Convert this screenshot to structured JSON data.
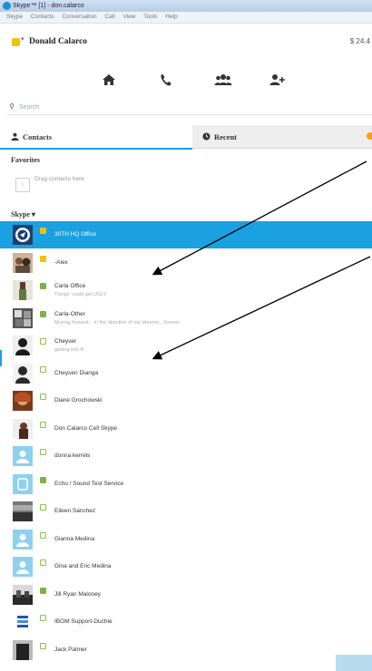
{
  "window": {
    "title": "Skype™ [1] - don.calarco"
  },
  "menu": [
    "Skype",
    "Contacts",
    "Conversation",
    "Call",
    "View",
    "Tools",
    "Help"
  ],
  "profile": {
    "name": "Donald Calarco",
    "credit": "$ 24.4"
  },
  "nav": [
    {
      "icon": "home-icon"
    },
    {
      "icon": "phone-icon"
    },
    {
      "icon": "group-icon"
    },
    {
      "icon": "add-contact-icon"
    }
  ],
  "search": {
    "placeholder": "Search"
  },
  "tabs": {
    "contacts": "Contacts",
    "recent": "Recent"
  },
  "favorites": {
    "label": "Favorites",
    "hint": "Drag contacts here",
    "box_text": "☆"
  },
  "skype_section": {
    "label": "Skype ▾"
  },
  "contacts": [
    {
      "name": "30TH HQ Office",
      "mood": "",
      "status": "away",
      "selected": true,
      "avatar": "logo"
    },
    {
      "name": "-Alex",
      "mood": "",
      "status": "away",
      "avatar": "photo-a"
    },
    {
      "name": "Carla Office",
      "mood": "Things' could get UGLY",
      "status": "online",
      "avatar": "photo-b"
    },
    {
      "name": "Carla-Other",
      "mood": "Moving forward... in the direction of our dreams... forever",
      "status": "online",
      "avatar": "photo-c"
    },
    {
      "name": "Cheyser",
      "mood": "getting into it!",
      "status": "offline",
      "avatar": "photo-d"
    },
    {
      "name": "Cheysen Dianga",
      "mood": "",
      "status": "offline",
      "avatar": "photo-e"
    },
    {
      "name": "Diane Grochowski",
      "mood": "",
      "status": "offline",
      "avatar": "photo-f"
    },
    {
      "name": "Don Calarco Cell Skype",
      "mood": "",
      "status": "offline",
      "avatar": "photo-g"
    },
    {
      "name": "donna kerrels",
      "mood": "",
      "status": "offline",
      "avatar": "default"
    },
    {
      "name": "Echo / Sound Test Service",
      "mood": "",
      "status": "online",
      "avatar": "echo"
    },
    {
      "name": "Eileen Sanchez",
      "mood": "",
      "status": "offline",
      "avatar": "photo-h"
    },
    {
      "name": "Gianna Medina",
      "mood": "",
      "status": "offline",
      "avatar": "default"
    },
    {
      "name": "Gina and Eric Medina",
      "mood": "",
      "status": "offline",
      "avatar": "default"
    },
    {
      "name": "Jill Ryan Maloney",
      "mood": "",
      "status": "online",
      "avatar": "photo-i"
    },
    {
      "name": "IBOM Support-Duchie",
      "mood": "",
      "status": "offline",
      "avatar": "photo-j"
    },
    {
      "name": "Jack Palmer",
      "mood": "",
      "status": "offline",
      "avatar": "photo-k"
    }
  ],
  "colors": {
    "accent": "#1ba0e1",
    "away": "#f2c200",
    "online": "#7cb342"
  }
}
